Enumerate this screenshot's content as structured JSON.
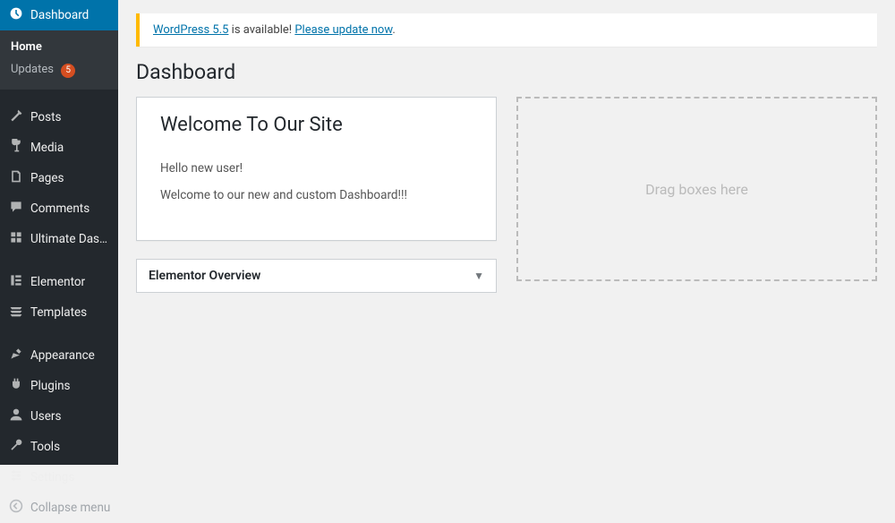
{
  "sidebar": {
    "items": [
      {
        "icon": "dashboard",
        "label": "Dashboard",
        "current": true
      },
      {
        "icon": "pin",
        "label": "Posts"
      },
      {
        "icon": "media",
        "label": "Media"
      },
      {
        "icon": "page",
        "label": "Pages"
      },
      {
        "icon": "comment",
        "label": "Comments"
      },
      {
        "icon": "udw",
        "label": "Ultimate Dash…"
      },
      {
        "icon": "elementor",
        "label": "Elementor"
      },
      {
        "icon": "templates",
        "label": "Templates"
      },
      {
        "icon": "appearance",
        "label": "Appearance"
      },
      {
        "icon": "plugins",
        "label": "Plugins"
      },
      {
        "icon": "users",
        "label": "Users"
      },
      {
        "icon": "tools",
        "label": "Tools"
      },
      {
        "icon": "settings",
        "label": "Settings"
      },
      {
        "icon": "collapse",
        "label": "Collapse menu"
      }
    ],
    "submenu": {
      "home": "Home",
      "updates": "Updates",
      "updates_count": "5"
    }
  },
  "notice": {
    "link1": "WordPress 5.5",
    "mid": " is available! ",
    "link2": "Please update now",
    "suffix": "."
  },
  "page_title": "Dashboard",
  "welcome": {
    "title": "Welcome To Our Site",
    "p1": "Hello new user!",
    "p2": "Welcome to our new and custom Dashboard!!!"
  },
  "overview": {
    "title": "Elementor Overview"
  },
  "dropzone": "Drag boxes here"
}
